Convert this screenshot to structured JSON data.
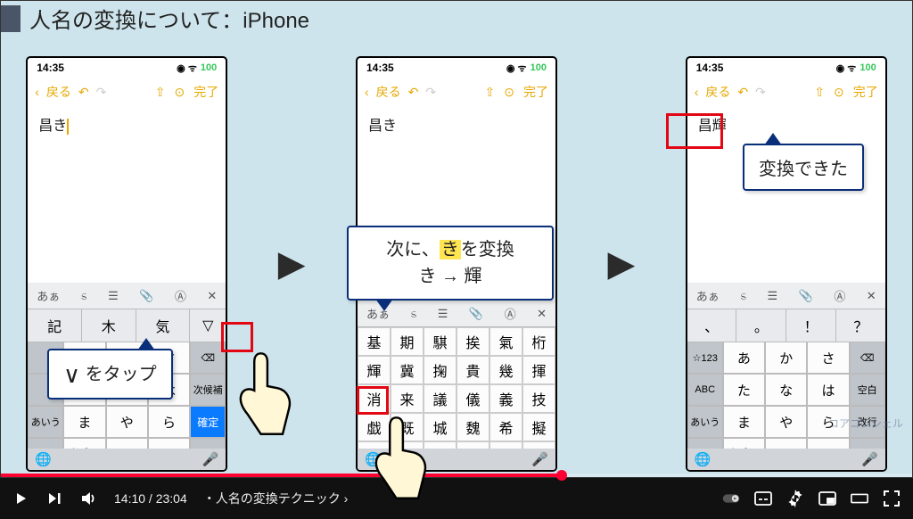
{
  "video": {
    "slide_title": "人名の変換について：iPhone",
    "callout1": "をタップ",
    "callout2_line1_pre": "次に、",
    "callout2_line1_hl": "き",
    "callout2_line1_post": "を変換",
    "callout2_line2": "き → 輝",
    "callout3": "変換できた",
    "watermark": "コアコンシェル"
  },
  "phone": {
    "time": "14:35",
    "battery": "100",
    "back_label": "戻る",
    "done_label": "完了",
    "note_text_1": "昌き",
    "note_text_2": "昌き",
    "note_text_3": "昌輝",
    "kbd_tabs": [
      "あぁ",
      "ಽ",
      "☰",
      "📎",
      "Ⓐ",
      "✕"
    ],
    "sug_row1": [
      "記",
      "木",
      "気",
      "▽"
    ],
    "sug_row3": [
      "、",
      "。",
      "！",
      "？"
    ],
    "kana_rows": [
      [
        "☆123",
        "あ",
        "か",
        "さ",
        "⌫"
      ],
      [
        "ABC",
        "た",
        "な",
        "は",
        "空白"
      ],
      [
        "あいう",
        "ま",
        "や",
        "ら",
        "改行"
      ],
      [
        "☺",
        "゛゜",
        "わ",
        "、?!",
        ""
      ]
    ],
    "kana_rows_1": [
      [
        "",
        "あ",
        "か",
        "さ",
        "⌫"
      ],
      [
        "",
        "た",
        "な",
        "は",
        "次候補"
      ],
      [
        "あいう",
        "ま",
        "や",
        "ら",
        "確定"
      ],
      [
        "☺",
        "゛゜",
        "わ",
        "、?!",
        ""
      ]
    ],
    "kanji_grid": [
      "基",
      "期",
      "騏",
      "挨",
      "氣",
      "桁",
      "輝",
      "冀",
      "掬",
      "貴",
      "幾",
      "揮",
      "消",
      "来",
      "議",
      "儀",
      "義",
      "技",
      "戯",
      "既",
      "城",
      "魏",
      "希",
      "擬",
      "",
      "",
      "",
      "",
      "",
      ""
    ]
  },
  "player": {
    "current_time": "14:10",
    "duration": "23:04",
    "chapter": "人名の変換テクニック"
  }
}
